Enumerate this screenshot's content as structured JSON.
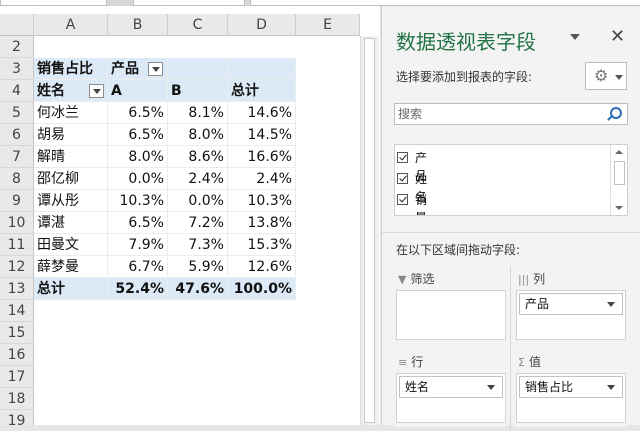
{
  "sheet": {
    "columns": [
      "A",
      "B",
      "C",
      "D",
      "E"
    ],
    "rows": [
      "2",
      "3",
      "4",
      "5",
      "6",
      "7",
      "8",
      "9",
      "10",
      "11",
      "12",
      "13",
      "14",
      "15",
      "16",
      "17",
      "18",
      "19"
    ],
    "pivot": {
      "title": "销售占比",
      "col_field": "产品",
      "row_field": "姓名",
      "col_a": "A",
      "col_b": "B",
      "total_header": "总计",
      "data": [
        {
          "name": "何冰兰",
          "a": "6.5%",
          "b": "8.1%",
          "t": "14.6%"
        },
        {
          "name": "胡易",
          "a": "6.5%",
          "b": "8.0%",
          "t": "14.5%"
        },
        {
          "name": "解晴",
          "a": "8.0%",
          "b": "8.6%",
          "t": "16.6%"
        },
        {
          "name": "邵亿柳",
          "a": "0.0%",
          "b": "2.4%",
          "t": "2.4%"
        },
        {
          "name": "谭从彤",
          "a": "10.3%",
          "b": "0.0%",
          "t": "10.3%"
        },
        {
          "name": "谭湛",
          "a": "6.5%",
          "b": "7.2%",
          "t": "13.8%"
        },
        {
          "name": "田曼文",
          "a": "7.9%",
          "b": "7.3%",
          "t": "15.3%"
        },
        {
          "name": "薛梦曼",
          "a": "6.7%",
          "b": "5.9%",
          "t": "12.6%"
        }
      ],
      "total_row": {
        "name": "总计",
        "a": "52.4%",
        "b": "47.6%",
        "t": "100.0%"
      }
    }
  },
  "pane": {
    "title": "数据透视表字段",
    "close": "✕",
    "subtitle": "选择要添加到报表的字段:",
    "gear": "⚙",
    "search_placeholder": "搜索",
    "fields": [
      "产品",
      "姓名",
      "销量"
    ],
    "drag_label": "在以下区域间拖动字段:",
    "areas": {
      "filter": {
        "label": "筛选",
        "icon": "▼"
      },
      "columns": {
        "label": "列",
        "icon": "|||",
        "item": "产品"
      },
      "rows": {
        "label": "行",
        "icon": "≡",
        "item": "姓名"
      },
      "values": {
        "label": "值",
        "icon": "Σ",
        "item": "销售占比"
      }
    }
  }
}
